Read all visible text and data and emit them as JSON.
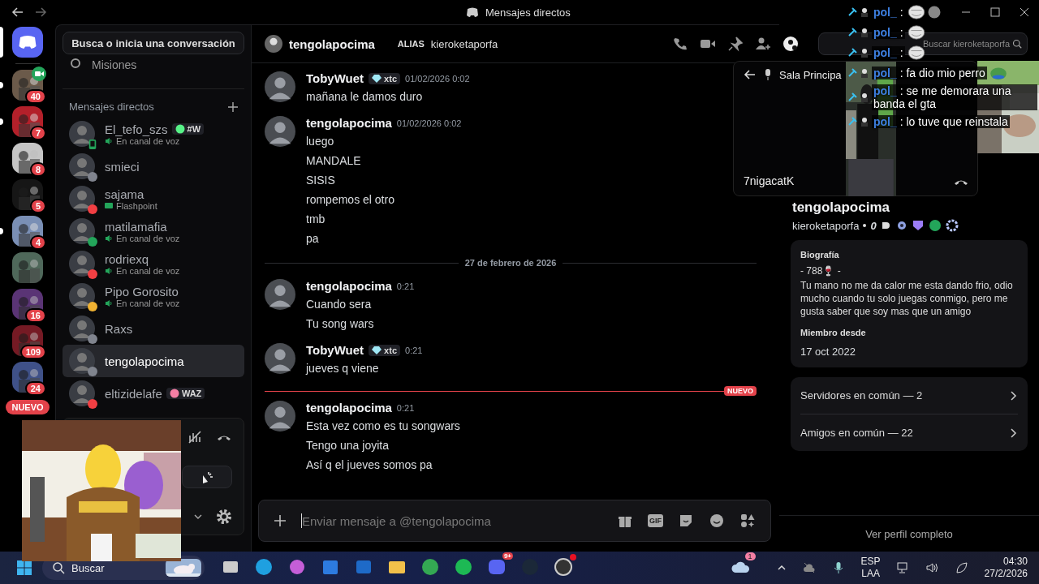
{
  "titlebar": {
    "title": "Mensajes directos"
  },
  "servers": [
    {
      "badge": "40",
      "unread": true,
      "video": true
    },
    {
      "badge": "7",
      "unread": true,
      "video": false
    },
    {
      "badge": "8",
      "unread": false,
      "video": false
    },
    {
      "badge": "5",
      "unread": false,
      "video": false
    },
    {
      "badge": "4",
      "unread": true,
      "video": false
    },
    {
      "unread": false,
      "video": false
    },
    {
      "badge": "16",
      "unread": false,
      "video": false
    },
    {
      "badge": "109",
      "unread": false,
      "video": false
    },
    {
      "badge": "24",
      "unread": false,
      "video": false
    }
  ],
  "new_badge": "NUEVO",
  "sidebar": {
    "search": "Busca o inicia una conversación",
    "quests": "Misiones",
    "dm_header": "Mensajes directos",
    "items": [
      {
        "name": "El_tefo_szs",
        "tag": {
          "text": "#W",
          "color": "#57f287"
        },
        "activity": {
          "kind": "voice",
          "text": "En canal de voz"
        },
        "color": "#23a55a",
        "mobile": true,
        "selected": false
      },
      {
        "name": "smieci",
        "color": "#80848e",
        "mobile": false,
        "selected": false
      },
      {
        "name": "sajama",
        "activity": {
          "kind": "game",
          "text": "Flashpoint"
        },
        "color": "#f23f43",
        "mobile": false,
        "selected": false
      },
      {
        "name": "matilamafia",
        "activity": {
          "kind": "voice",
          "text": "En canal de voz"
        },
        "color": "#23a55a",
        "mobile": false,
        "selected": false
      },
      {
        "name": "rodriexq",
        "activity": {
          "kind": "voice",
          "text": "En canal de voz"
        },
        "color": "#f23f43",
        "mobile": false,
        "selected": false
      },
      {
        "name": "Pipo Gorosito",
        "activity": {
          "kind": "voice",
          "text": "En canal de voz"
        },
        "color": "#f0b232",
        "mobile": false,
        "selected": false
      },
      {
        "name": "Raxs",
        "color": "#80848e",
        "mobile": false,
        "selected": false
      },
      {
        "name": "tengolapocima",
        "color": "#80848e",
        "mobile": false,
        "selected": true
      },
      {
        "name": "eltizidelafe",
        "tag": {
          "text": "WAZ",
          "color": "#f47fa4"
        },
        "color": "#f23f43",
        "mobile": false,
        "selected": false
      }
    ]
  },
  "header": {
    "name": "tengolapocima",
    "alias_label": "ALIAS",
    "alias": "kieroketaporfa",
    "search_placeholder": "Buscar kieroketaporfa"
  },
  "messages": [
    {
      "kind": "group",
      "author": "TobyWuet",
      "tag": "xtc",
      "time": "01/02/2026 0:02",
      "lines": [
        "mañana le damos duro"
      ]
    },
    {
      "kind": "group",
      "author": "tengolapocima",
      "time": "01/02/2026 0:02",
      "lines": [
        "luego",
        "MANDALE",
        "SISIS",
        "rompemos el otro",
        "tmb",
        "pa"
      ]
    },
    {
      "kind": "date",
      "text": "27 de febrero de 2026"
    },
    {
      "kind": "group",
      "author": "tengolapocima",
      "time": "0:21",
      "lines": [
        "Cuando sera",
        "Tu song wars"
      ]
    },
    {
      "kind": "group",
      "author": "TobyWuet",
      "tag": "xtc",
      "time": "0:21",
      "lines": [
        "jueves q viene"
      ]
    },
    {
      "kind": "new",
      "text": "NUEVO"
    },
    {
      "kind": "group",
      "author": "tengolapocima",
      "time": "0:21",
      "lines": [
        "Esta vez como es tu songwars",
        "Tengo una joyita",
        "Así q el jueves somos pa"
      ]
    }
  ],
  "composer": {
    "placeholder": "Enviar mensaje a @tengolapocima",
    "gif": "GIF"
  },
  "call": {
    "room": "Sala Principa",
    "user": "7nigacatK"
  },
  "overlay_chat": [
    {
      "kind": "emote",
      "author": "pol_",
      "text": ":"
    },
    {
      "kind": "emote",
      "author": "pol_",
      "text": ":"
    },
    {
      "kind": "emote",
      "author": "pol_",
      "text": ":"
    },
    {
      "kind": "text",
      "author": "pol_",
      "text": ": fa dio mio perro",
      "emote": true
    },
    {
      "kind": "text",
      "author": "pol_",
      "text": ": se me demorara una banda el gta",
      "emote": false
    },
    {
      "kind": "text",
      "author": "pol_",
      "text": ": lo tuve que reinstala",
      "emote": false
    }
  ],
  "profile": {
    "name": "tengolapocima",
    "username": "kieroketaporfa",
    "extra": "0",
    "bio_title": "Biografía",
    "bio_head": "- 788🍷 -",
    "bio": "Tu mano no me da calor me esta dando frio, odio mucho cuando tu solo juegas conmigo, pero me gusta saber que soy mas que un amigo",
    "since_title": "Miembro desde",
    "since": "17 oct 2022",
    "mutual": [
      "Servidores en común — 2",
      "Amigos en común — 22"
    ],
    "full": "Ver perfil completo"
  },
  "taskbar": {
    "search": "Buscar",
    "discord_badge": "9+",
    "weather_badge": "1",
    "lang": "ESP",
    "layout": "LAA",
    "time": "04:30",
    "date": "27/2/2026"
  }
}
